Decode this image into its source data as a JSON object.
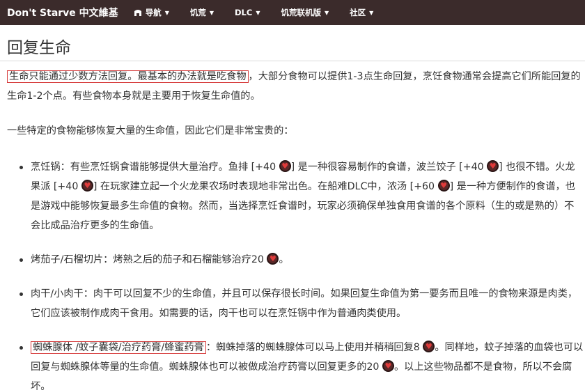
{
  "nav": {
    "brand": "Don't Starve 中文維基",
    "items": [
      {
        "label": "导航",
        "icon": "compass-icon"
      },
      {
        "label": "饥荒"
      },
      {
        "label": "DLC"
      },
      {
        "label": "饥荒联机版"
      },
      {
        "label": "社区"
      }
    ]
  },
  "heading": "回复生命",
  "intro": {
    "highlight": "生命只能通过少数方法回复。最基本的办法就是吃食物",
    "rest": "，大部分食物可以提供1-3点生命回复，烹饪食物通常会提高它们所能回复的生命1-2个点。有些食物本身就是主要用于恢复生命值的。"
  },
  "lead": "一些特定的食物能够恢复大量的生命值，因此它们是非常宝贵的：",
  "items": [
    {
      "s1": "烹饪锅：有些烹饪锅食谱能够提供大量治疗。鱼排 [+40 ",
      "s2": "] 是一种很容易制作的食谱，波兰饺子 [+40 ",
      "s3": "] 也很不错。火龙果派 [+40 ",
      "s4": "] 在玩家建立起一个火龙果农场时表现地非常出色。在船难DLC中，浓汤 [+60 ",
      "s5": "] 是一种方便制作的食谱，也是游戏中能够恢复最多生命值的食物。然而，当选择烹饪食谱时，玩家必须确保单独食用食谱的各个原料（生的或是熟的）不会比成品治疗更多的生命值。"
    },
    {
      "s1": "烤茄子/石榴切片：烤熟之后的茄子和石榴能够治疗20 ",
      "s2": "。"
    },
    {
      "s1": "肉干/小肉干：肉干可以回复不少的生命值，并且可以保存很长时间。如果回复生命值为第一要务而且唯一的食物来源是肉类，它们应该被制作成肉干食用。如需要的话，肉干也可以在烹饪锅中作为普通肉类使用。"
    },
    {
      "highlight": "蜘蛛腺体 /蚊子囊袋/治疗药膏/蜂蜜药膏",
      "s1": "：蜘蛛掉落的蜘蛛腺体可以马上使用并稍稍回复8 ",
      "s2": "。同样地，蚊子掉落的血袋也可以回复与蜘蛛腺体等量的生命值。蜘蛛腺体也可以被做成治疗药膏以回复更多的20 ",
      "s3": "。以上这些物品都不是食物，所以不会腐坏。"
    }
  ]
}
